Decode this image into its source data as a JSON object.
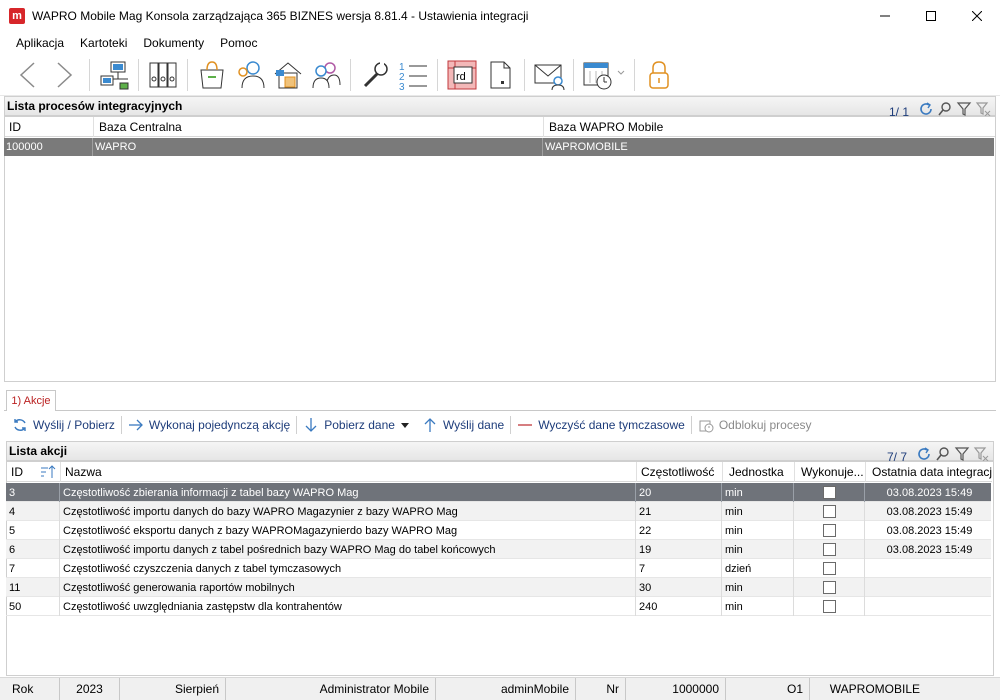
{
  "window": {
    "title": "WAPRO Mobile Mag Konsola zarządzająca 365 BIZNES wersja 8.81.4 - Ustawienia integracji",
    "app_icon_letter": "m"
  },
  "menu": [
    "Aplikacja",
    "Kartoteki",
    "Dokumenty",
    "Pomoc"
  ],
  "process_panel": {
    "title": "Lista procesów integracyjnych",
    "counter": "1/ 1",
    "columns": [
      "ID",
      "Baza Centralna",
      "Baza WAPRO Mobile"
    ],
    "rows": [
      {
        "id": "100000",
        "central": "WAPRO",
        "mobile": "WAPROMOBILE"
      }
    ]
  },
  "tab": {
    "label": "1) Akcje"
  },
  "actions_toolbar": {
    "send_receive": "Wyślij / Pobierz",
    "run_single": "Wykonaj pojedynczą akcję",
    "download": "Pobierz dane",
    "send": "Wyślij dane",
    "clear_temp": "Wyczyść dane tymczasowe",
    "unlock": "Odblokuj procesy"
  },
  "actions_panel": {
    "title": "Lista akcji",
    "counter": "7/ 7",
    "columns": [
      "ID",
      "Nazwa",
      "Częstotliwość",
      "Jednostka",
      "Wykonuje...",
      "Ostatnia data integracji"
    ],
    "rows": [
      {
        "id": "3",
        "name": "Częstotliwość zbierania informacji z tabel bazy WAPRO Mag",
        "freq": "20",
        "unit": "min",
        "last": "03.08.2023 15:49"
      },
      {
        "id": "4",
        "name": "Częstotliwość importu danych do bazy WAPRO Magazynier z bazy WAPRO Mag",
        "freq": "21",
        "unit": "min",
        "last": "03.08.2023 15:49"
      },
      {
        "id": "5",
        "name": "Częstotliwość eksportu danych z bazy WAPROMagazynierdo bazy WAPRO Mag",
        "freq": "22",
        "unit": "min",
        "last": "03.08.2023 15:49"
      },
      {
        "id": "6",
        "name": "Częstotliwość importu danych z tabel pośrednich bazy WAPRO Mag do tabel końcowych",
        "freq": "19",
        "unit": "min",
        "last": "03.08.2023 15:49"
      },
      {
        "id": "7",
        "name": "Częstotliwość czyszczenia danych z tabel tymczasowych",
        "freq": "7",
        "unit": "dzień",
        "last": ""
      },
      {
        "id": "11",
        "name": "Częstotliwość generowania raportów mobilnych",
        "freq": "30",
        "unit": "min",
        "last": ""
      },
      {
        "id": "50",
        "name": "Częstotliwość uwzględniania zastępstw dla kontrahentów",
        "freq": "240",
        "unit": "min",
        "last": ""
      }
    ]
  },
  "status": {
    "rok_label": "Rok",
    "rok_value": "2023",
    "month": "Sierpień",
    "user": "Administrator Mobile",
    "login": "adminMobile",
    "nr_label": "Nr",
    "nr_value": "1000000",
    "o1": "O1",
    "db": "WAPROMOBILE"
  },
  "colors": {
    "brand": "#d7262a",
    "selection": "#6f737a",
    "link": "#1d3c7a"
  }
}
